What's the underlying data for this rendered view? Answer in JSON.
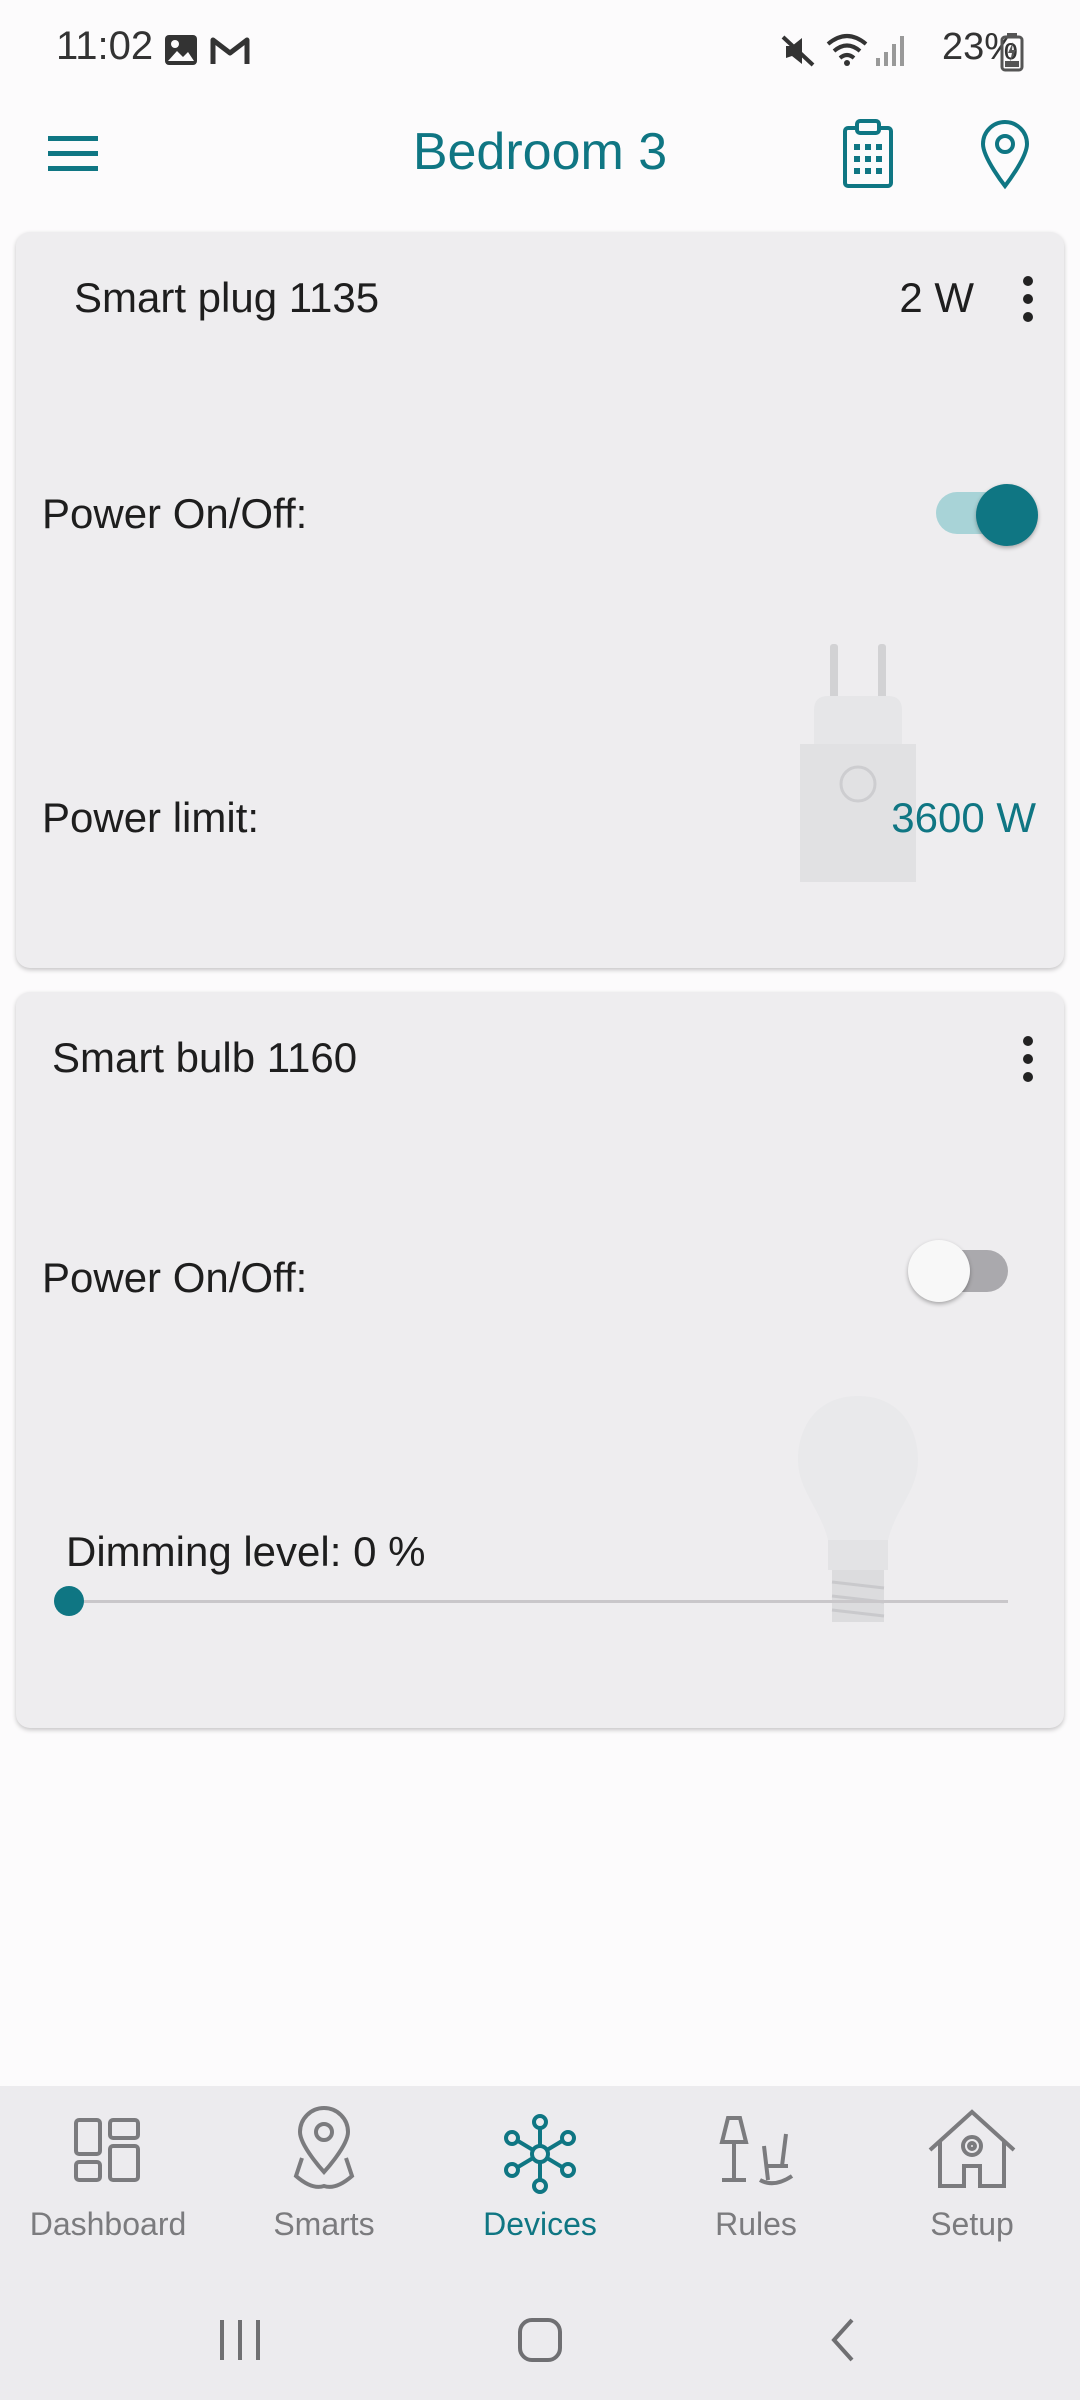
{
  "status_bar": {
    "time": "11:02",
    "battery": "23%",
    "icons": [
      "image-icon",
      "gmail-icon",
      "mute-icon",
      "wifi-icon",
      "signal-icon",
      "battery-icon"
    ]
  },
  "app_bar": {
    "title": "Bedroom 3",
    "icons": [
      "menu-icon",
      "clipboard-icon",
      "location-pin-icon"
    ]
  },
  "devices": [
    {
      "name": "Smart plug 1135",
      "consumption": "2 W",
      "power_label": "Power On/Off:",
      "power_on": true,
      "limit_label": "Power limit:",
      "limit_value": "3600 W"
    },
    {
      "name": "Smart bulb 1160",
      "power_label": "Power On/Off:",
      "power_on": false,
      "dimming_label": "Dimming level: 0 %",
      "dimming_level": 0
    }
  ],
  "bottom_nav": [
    {
      "label": "Dashboard",
      "icon": "dashboard-icon",
      "active": false
    },
    {
      "label": "Smarts",
      "icon": "smarts-icon",
      "active": false
    },
    {
      "label": "Devices",
      "icon": "devices-icon",
      "active": true
    },
    {
      "label": "Rules",
      "icon": "rules-icon",
      "active": false
    },
    {
      "label": "Setup",
      "icon": "setup-icon",
      "active": false
    }
  ],
  "colors": {
    "accent": "#0f7683",
    "card": "#eeedef",
    "nav_inactive": "#7b7b7e"
  }
}
